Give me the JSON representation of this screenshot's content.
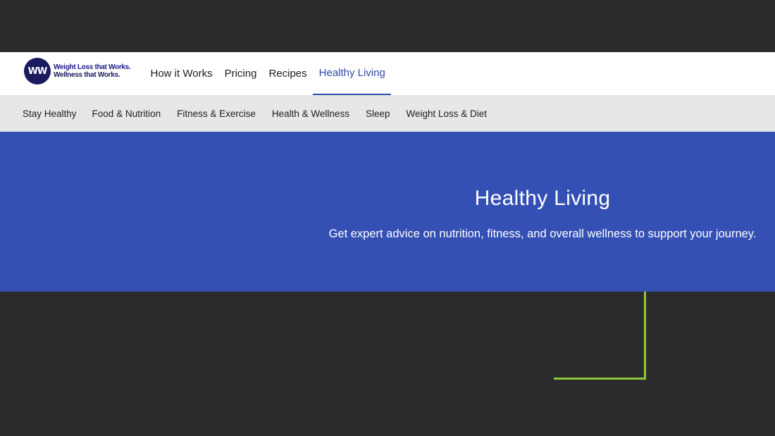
{
  "logo": {
    "mark": "WW",
    "tagline_1": "Weight Loss that Works.",
    "tagline_2": "Wellness that Works."
  },
  "main_nav": [
    {
      "label": "How it Works"
    },
    {
      "label": "Pricing"
    },
    {
      "label": "Recipes"
    },
    {
      "label": "Healthy Living",
      "active": true
    }
  ],
  "sub_nav": [
    {
      "label": "Stay Healthy"
    },
    {
      "label": "Food & Nutrition"
    },
    {
      "label": "Fitness & Exercise"
    },
    {
      "label": "Health & Wellness"
    },
    {
      "label": "Sleep"
    },
    {
      "label": "Weight Loss & Diet"
    }
  ],
  "hero": {
    "title": "Healthy Living",
    "subtitle": "Get expert advice on nutrition, fitness, and overall wellness to support your journey."
  },
  "colors": {
    "brand_navy": "#1a1a5e",
    "hero_blue": "#3450b5",
    "active_link": "#2f4aa8",
    "accent_green": "#8dc63f"
  }
}
